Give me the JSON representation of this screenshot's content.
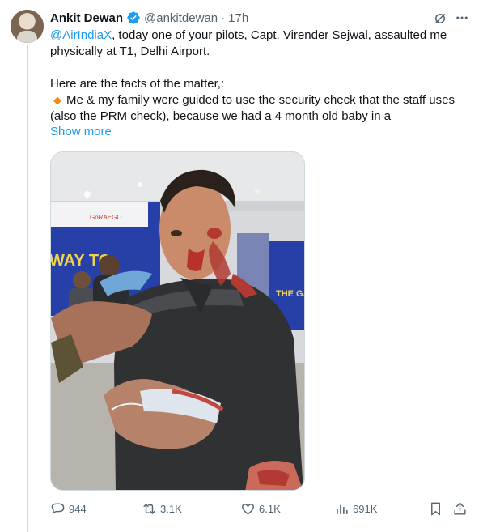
{
  "tweet": {
    "author_name": "Ankit Dewan",
    "handle": "@ankitdewan",
    "separator": "·",
    "time": "17h",
    "mention": "@AirIndiaX",
    "line1_rest": ", today one of your pilots, Capt. Virender Sejwal, assaulted me physically at T1, Delhi Airport.",
    "line2": "Here are the facts of the matter,:",
    "line3": "Me & my family were guided to use the security check that the staff uses (also the PRM check), because we had a 4 month old baby in a",
    "show_more": "Show more"
  },
  "icons": {
    "verified": "verified-badge-icon",
    "grok": "grok-icon",
    "more": "more-icon",
    "bullet": "orange-diamond-icon"
  },
  "media": {
    "sign_text_left": "WAY TO",
    "sign_text_right": "THE GA",
    "sign_brand": "GoRAEGO"
  },
  "actions": {
    "replies": "944",
    "reposts": "3.1K",
    "likes": "6.1K",
    "views": "691K"
  },
  "colors": {
    "accent": "#1d9bf0",
    "muted": "#536471",
    "text": "#0f1419",
    "bullet": "#f08a1a"
  }
}
